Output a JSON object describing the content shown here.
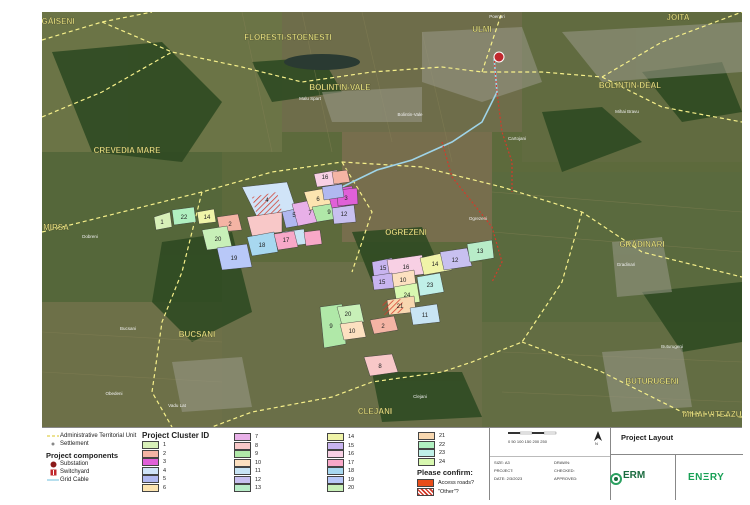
{
  "map": {
    "place_labels": [
      "GĂISENI",
      "FLORESTI-STOENESTI",
      "ULMI",
      "JOITA",
      "BOLINTIN-VALE",
      "BOLINTIN-DEAL",
      "CREVEDIA MARE",
      "OGREZENI",
      "GRĂDINARI",
      "MIRSA",
      "BUCSANI",
      "BUTURUGENI",
      "CLEJANI",
      "MIHAI VITEAZU"
    ],
    "small_labels": [
      "Poenari",
      "Malu Spart",
      "Bolintin-Vale",
      "Cartojani",
      "Ogrezeni",
      "Bucsani",
      "Vadu Lat",
      "Clejani",
      "Buturugeni",
      "Gradinari",
      "Obedeni",
      "Dobreni",
      "Mihai Bravu"
    ],
    "cluster_numbers": [
      "1",
      "2",
      "3",
      "4",
      "5",
      "6",
      "7",
      "8",
      "9",
      "10",
      "11",
      "12",
      "13",
      "14",
      "15",
      "16",
      "17",
      "18",
      "19",
      "20",
      "21",
      "22",
      "23",
      "24"
    ]
  },
  "legend": {
    "atu_label": "Administrative Territorial Unit",
    "settlement_label": "Settlement",
    "components_title": "Project components",
    "substation_label": "Substation",
    "switchyard_label": "Switchyard",
    "gridcable_label": "Grid Cable"
  },
  "clusters": {
    "title": "Project Cluster ID",
    "items": [
      {
        "id": "1",
        "color": "#d8f0b8"
      },
      {
        "id": "2",
        "color": "#f4b4a4"
      },
      {
        "id": "3",
        "color": "#e060d8"
      },
      {
        "id": "4",
        "color": "#d0e4f8"
      },
      {
        "id": "5",
        "color": "#b0b8f0"
      },
      {
        "id": "6",
        "color": "#fce4b0"
      },
      {
        "id": "7",
        "color": "#e8b0e8"
      },
      {
        "id": "8",
        "color": "#f8c8c8"
      },
      {
        "id": "9",
        "color": "#b0e8a8"
      },
      {
        "id": "10",
        "color": "#fce0c0"
      },
      {
        "id": "11",
        "color": "#c8e4f4"
      },
      {
        "id": "12",
        "color": "#c8c0f0"
      },
      {
        "id": "13",
        "color": "#b8ecc8"
      },
      {
        "id": "14",
        "color": "#f0f4a8"
      },
      {
        "id": "15",
        "color": "#c8b4f0"
      },
      {
        "id": "16",
        "color": "#f8d0e4"
      },
      {
        "id": "17",
        "color": "#f8a8c8"
      },
      {
        "id": "18",
        "color": "#a8d8f0"
      },
      {
        "id": "19",
        "color": "#b8c8f8"
      },
      {
        "id": "20",
        "color": "#c8f0b8"
      },
      {
        "id": "21",
        "color": "#f8d8b0"
      },
      {
        "id": "22",
        "color": "#b0f0c0"
      },
      {
        "id": "23",
        "color": "#c0f0e8"
      },
      {
        "id": "24",
        "color": "#d8f8b0"
      }
    ]
  },
  "confirm": {
    "title": "Please confirm:",
    "access_label": "Access roads?",
    "other_label": "\"Other\"?"
  },
  "title_block": {
    "title": "Project Layout",
    "scale_ticks": "0 50 100 150 200 250",
    "north": "N",
    "fields": [
      "SIZE: A3",
      "PROJECT:",
      "DATE: 2/3/2023",
      "DRAWN:",
      "CHECKED:",
      "APPROVED:"
    ],
    "erm": "ERM",
    "enery": "ENΞRY"
  },
  "colors": {
    "boundary": "#f6f08a",
    "grid_cable": "#9fd4e8",
    "access_road": "#d43a2a"
  }
}
